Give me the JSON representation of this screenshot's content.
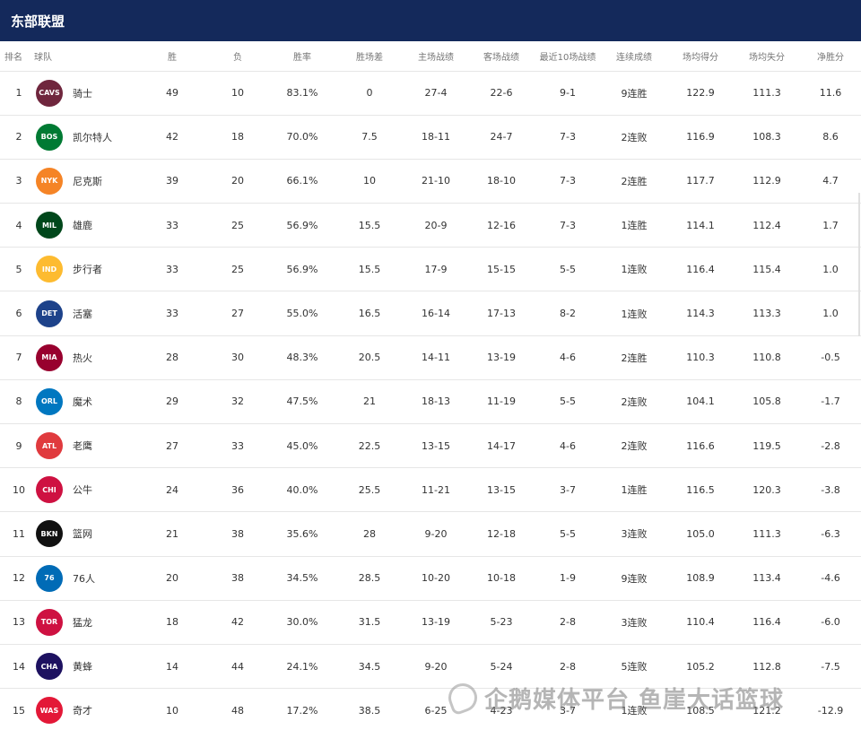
{
  "header": {
    "title": "东部联盟"
  },
  "columns": {
    "rank": "排名",
    "team": "球队",
    "wins": "胜",
    "losses": "负",
    "pct": "胜率",
    "gb": "胜场差",
    "home": "主场战绩",
    "away": "客场战绩",
    "last10": "最近10场战绩",
    "streak": "连续成绩",
    "ppg": "场均得分",
    "oppg": "场均失分",
    "diff": "净胜分"
  },
  "teams": [
    {
      "rank": "1",
      "name": "骑士",
      "logo": "CAVS",
      "color": "#6f263d",
      "wins": "49",
      "losses": "10",
      "pct": "83.1%",
      "gb": "0",
      "home": "27-4",
      "away": "22-6",
      "last10": "9-1",
      "streak": "9连胜",
      "ppg": "122.9",
      "oppg": "111.3",
      "diff": "11.6"
    },
    {
      "rank": "2",
      "name": "凯尔特人",
      "logo": "BOS",
      "color": "#007a33",
      "wins": "42",
      "losses": "18",
      "pct": "70.0%",
      "gb": "7.5",
      "home": "18-11",
      "away": "24-7",
      "last10": "7-3",
      "streak": "2连败",
      "ppg": "116.9",
      "oppg": "108.3",
      "diff": "8.6"
    },
    {
      "rank": "3",
      "name": "尼克斯",
      "logo": "NYK",
      "color": "#f58426",
      "wins": "39",
      "losses": "20",
      "pct": "66.1%",
      "gb": "10",
      "home": "21-10",
      "away": "18-10",
      "last10": "7-3",
      "streak": "2连胜",
      "ppg": "117.7",
      "oppg": "112.9",
      "diff": "4.7"
    },
    {
      "rank": "4",
      "name": "雄鹿",
      "logo": "MIL",
      "color": "#00471b",
      "wins": "33",
      "losses": "25",
      "pct": "56.9%",
      "gb": "15.5",
      "home": "20-9",
      "away": "12-16",
      "last10": "7-3",
      "streak": "1连胜",
      "ppg": "114.1",
      "oppg": "112.4",
      "diff": "1.7"
    },
    {
      "rank": "5",
      "name": "步行者",
      "logo": "IND",
      "color": "#fdbb30",
      "wins": "33",
      "losses": "25",
      "pct": "56.9%",
      "gb": "15.5",
      "home": "17-9",
      "away": "15-15",
      "last10": "5-5",
      "streak": "1连败",
      "ppg": "116.4",
      "oppg": "115.4",
      "diff": "1.0"
    },
    {
      "rank": "6",
      "name": "活塞",
      "logo": "DET",
      "color": "#1d428a",
      "wins": "33",
      "losses": "27",
      "pct": "55.0%",
      "gb": "16.5",
      "home": "16-14",
      "away": "17-13",
      "last10": "8-2",
      "streak": "1连败",
      "ppg": "114.3",
      "oppg": "113.3",
      "diff": "1.0"
    },
    {
      "rank": "7",
      "name": "热火",
      "logo": "MIA",
      "color": "#98002e",
      "wins": "28",
      "losses": "30",
      "pct": "48.3%",
      "gb": "20.5",
      "home": "14-11",
      "away": "13-19",
      "last10": "4-6",
      "streak": "2连胜",
      "ppg": "110.3",
      "oppg": "110.8",
      "diff": "-0.5"
    },
    {
      "rank": "8",
      "name": "魔术",
      "logo": "ORL",
      "color": "#0077c0",
      "wins": "29",
      "losses": "32",
      "pct": "47.5%",
      "gb": "21",
      "home": "18-13",
      "away": "11-19",
      "last10": "5-5",
      "streak": "2连败",
      "ppg": "104.1",
      "oppg": "105.8",
      "diff": "-1.7"
    },
    {
      "rank": "9",
      "name": "老鹰",
      "logo": "ATL",
      "color": "#e03a3e",
      "wins": "27",
      "losses": "33",
      "pct": "45.0%",
      "gb": "22.5",
      "home": "13-15",
      "away": "14-17",
      "last10": "4-6",
      "streak": "2连败",
      "ppg": "116.6",
      "oppg": "119.5",
      "diff": "-2.8"
    },
    {
      "rank": "10",
      "name": "公牛",
      "logo": "CHI",
      "color": "#ce1141",
      "wins": "24",
      "losses": "36",
      "pct": "40.0%",
      "gb": "25.5",
      "home": "11-21",
      "away": "13-15",
      "last10": "3-7",
      "streak": "1连胜",
      "ppg": "116.5",
      "oppg": "120.3",
      "diff": "-3.8"
    },
    {
      "rank": "11",
      "name": "篮网",
      "logo": "BKN",
      "color": "#111111",
      "wins": "21",
      "losses": "38",
      "pct": "35.6%",
      "gb": "28",
      "home": "9-20",
      "away": "12-18",
      "last10": "5-5",
      "streak": "3连败",
      "ppg": "105.0",
      "oppg": "111.3",
      "diff": "-6.3"
    },
    {
      "rank": "12",
      "name": "76人",
      "logo": "76",
      "color": "#006bb6",
      "wins": "20",
      "losses": "38",
      "pct": "34.5%",
      "gb": "28.5",
      "home": "10-20",
      "away": "10-18",
      "last10": "1-9",
      "streak": "9连败",
      "ppg": "108.9",
      "oppg": "113.4",
      "diff": "-4.6"
    },
    {
      "rank": "13",
      "name": "猛龙",
      "logo": "TOR",
      "color": "#ce1141",
      "wins": "18",
      "losses": "42",
      "pct": "30.0%",
      "gb": "31.5",
      "home": "13-19",
      "away": "5-23",
      "last10": "2-8",
      "streak": "3连败",
      "ppg": "110.4",
      "oppg": "116.4",
      "diff": "-6.0"
    },
    {
      "rank": "14",
      "name": "黄蜂",
      "logo": "CHA",
      "color": "#1d1160",
      "wins": "14",
      "losses": "44",
      "pct": "24.1%",
      "gb": "34.5",
      "home": "9-20",
      "away": "5-24",
      "last10": "2-8",
      "streak": "5连败",
      "ppg": "105.2",
      "oppg": "112.8",
      "diff": "-7.5"
    },
    {
      "rank": "15",
      "name": "奇才",
      "logo": "WAS",
      "color": "#e31837",
      "wins": "10",
      "losses": "48",
      "pct": "17.2%",
      "gb": "38.5",
      "home": "6-25",
      "away": "4-23",
      "last10": "3-7",
      "streak": "1连败",
      "ppg": "108.5",
      "oppg": "121.2",
      "diff": "-12.9"
    }
  ],
  "watermark": {
    "text": "企鹅媒体平台 鱼崖大话篮球"
  }
}
